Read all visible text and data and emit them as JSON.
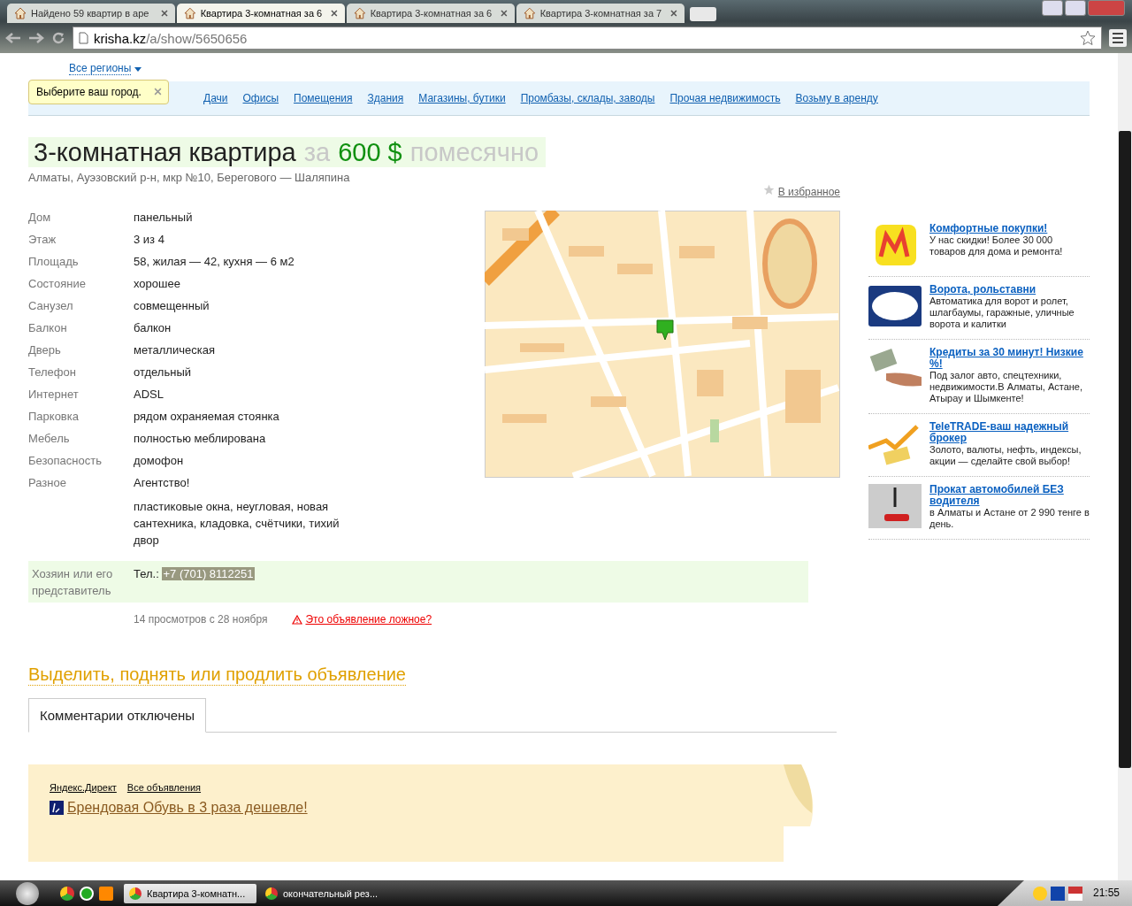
{
  "browser": {
    "tabs": [
      {
        "title": "Найдено 59 квартир в аре",
        "selected": false
      },
      {
        "title": "Квартира 3-комнатная за 6",
        "selected": true
      },
      {
        "title": "Квартира 3-комнатная за 6",
        "selected": false
      },
      {
        "title": "Квартира 3-комнатная за 7",
        "selected": false
      }
    ],
    "address": {
      "host": "krisha.kz",
      "path": "/a/show/5650656"
    }
  },
  "page": {
    "region_link": "Все регионы",
    "tooltip": "Выберите ваш город.",
    "nav": [
      "Дачи",
      "Офисы",
      "Помещения",
      "Здания",
      "Магазины, бутики",
      "Промбазы, склады, заводы",
      "Прочая недвижимость",
      "Возьму в аренду"
    ],
    "title": {
      "name": "3-комнатная квартира",
      "price_prefix": "за",
      "price": "600 $",
      "period": "помесячно"
    },
    "address": "Алматы, Ауэзовский р-н, мкр №10, Берегового — Шаляпина",
    "favorite": "В избранное",
    "details": [
      {
        "label": "Дом",
        "value": "панельный"
      },
      {
        "label": "Этаж",
        "value": "3 из 4"
      },
      {
        "label": "Площадь",
        "value": "58, жилая — 42, кухня — 6 м2"
      },
      {
        "label": "Состояние",
        "value": "хорошее"
      },
      {
        "label": "Санузел",
        "value": "совмещенный"
      },
      {
        "label": "Балкон",
        "value": "балкон"
      },
      {
        "label": "Дверь",
        "value": "металлическая"
      },
      {
        "label": "Телефон",
        "value": "отдельный"
      },
      {
        "label": "Интернет",
        "value": "ADSL"
      },
      {
        "label": "Парковка",
        "value": "рядом охраняемая стоянка"
      },
      {
        "label": "Мебель",
        "value": "полностью меблирована"
      },
      {
        "label": "Безопасность",
        "value": "домофон"
      },
      {
        "label": "Разное",
        "value": "Агентство!"
      }
    ],
    "extra": "пластиковые окна, неугловая, новая сантехника, кладовка, счётчики, тихий двор",
    "contact": {
      "label": "Хозяин или его представитель",
      "phone_label": "Тел.:",
      "phone": "+7 (701) 8112251"
    },
    "views": "14 просмотров с 28 ноября",
    "report": "Это объявление ложное?",
    "promote": "Выделить, поднять или продлить объявление",
    "comments_tab": "Комментарии отключены",
    "direct": {
      "links": [
        "Яндекс.Директ",
        "Все объявления"
      ],
      "ad": "Брендовая Обувь в 3 раза дешевле!"
    }
  },
  "ads": [
    {
      "title": "Комфортные покупки!",
      "text": "У нас скидки! Более 30 000 товаров для дома и ремонта!"
    },
    {
      "title": "Ворота, рольставни",
      "text": "Автоматика для ворот и ролет, шлагбаумы, гаражные, уличные ворота и калитки"
    },
    {
      "title": "Кредиты за 30 минут! Низкие %!",
      "text": "Под залог авто, спецтехники, недвижимости.В Алматы, Астане, Атырау и Шымкенте!"
    },
    {
      "title": "TeleTRADE-ваш надежный брокер",
      "text": "Золото, валюты, нефть, индексы, акции — сделайте свой выбор!"
    },
    {
      "title": "Прокат автомобилей БЕЗ водителя",
      "text": "в Алматы и Астане от 2 990 тенге в день."
    }
  ],
  "taskbar": {
    "items": [
      {
        "title": "Квартира 3-комнатн...",
        "selected": true
      },
      {
        "title": "окончательный рез...",
        "selected": false
      }
    ],
    "time": "21:55"
  }
}
